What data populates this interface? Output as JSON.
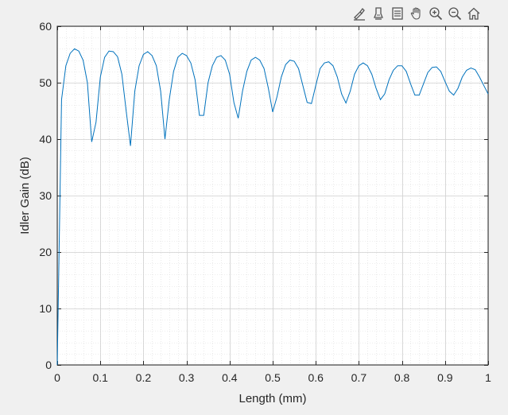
{
  "toolbar": {
    "items": [
      {
        "name": "brush-icon"
      },
      {
        "name": "data-tips-icon"
      },
      {
        "name": "legend-icon"
      },
      {
        "name": "pan-hand-icon"
      },
      {
        "name": "zoom-in-icon"
      },
      {
        "name": "zoom-out-icon"
      },
      {
        "name": "home-icon"
      }
    ]
  },
  "colors": {
    "background": "#f0f0f0",
    "axes_bg": "#ffffff",
    "line": "#0072bd",
    "axis": "#262626"
  },
  "chart_data": {
    "type": "line",
    "title": "",
    "xlabel": "Length (mm)",
    "ylabel": "Idler Gain (dB)",
    "xlim": [
      0,
      1
    ],
    "ylim": [
      0,
      60
    ],
    "xticks": [
      0,
      0.1,
      0.2,
      0.3,
      0.4,
      0.5,
      0.6,
      0.7,
      0.8,
      0.9,
      1
    ],
    "xtick_labels": [
      "0",
      "0.1",
      "0.2",
      "0.3",
      "0.4",
      "0.5",
      "0.6",
      "0.7",
      "0.8",
      "0.9",
      "1"
    ],
    "yticks": [
      0,
      10,
      20,
      30,
      40,
      50,
      60
    ],
    "ytick_labels": [
      "0",
      "10",
      "20",
      "30",
      "40",
      "50",
      "60"
    ],
    "grid": true,
    "minor_grid": true,
    "series": [
      {
        "x": [
          0,
          0.01,
          0.02,
          0.03,
          0.04,
          0.05,
          0.06,
          0.07,
          0.08,
          0.09,
          0.1,
          0.11,
          0.12,
          0.13,
          0.14,
          0.15,
          0.16,
          0.17,
          0.18,
          0.19,
          0.2,
          0.21,
          0.22,
          0.23,
          0.24,
          0.25,
          0.26,
          0.27,
          0.28,
          0.29,
          0.3,
          0.31,
          0.32,
          0.33,
          0.34,
          0.35,
          0.36,
          0.37,
          0.38,
          0.39,
          0.4,
          0.41,
          0.42,
          0.43,
          0.44,
          0.45,
          0.46,
          0.47,
          0.48,
          0.49,
          0.5,
          0.51,
          0.52,
          0.53,
          0.54,
          0.55,
          0.56,
          0.57,
          0.58,
          0.59,
          0.6,
          0.61,
          0.62,
          0.63,
          0.64,
          0.65,
          0.66,
          0.67,
          0.68,
          0.69,
          0.7,
          0.71,
          0.72,
          0.73,
          0.74,
          0.75,
          0.76,
          0.77,
          0.78,
          0.79,
          0.8,
          0.81,
          0.82,
          0.83,
          0.84,
          0.85,
          0.86,
          0.87,
          0.88,
          0.89,
          0.9,
          0.91,
          0.92,
          0.93,
          0.94,
          0.95,
          0.96,
          0.97,
          0.98,
          0.99,
          1.0
        ],
        "y": [
          0,
          47,
          53,
          55.2,
          56,
          55.6,
          54,
          50,
          39.5,
          43,
          51,
          54.5,
          55.6,
          55.5,
          54.6,
          51.5,
          45,
          38.8,
          48.5,
          53,
          55,
          55.5,
          54.8,
          53,
          48.5,
          40,
          47,
          52,
          54.5,
          55.2,
          54.8,
          53.5,
          50.5,
          44.2,
          44.2,
          50,
          53,
          54.5,
          54.8,
          54,
          51.5,
          46.5,
          43.7,
          48.5,
          52,
          54,
          54.5,
          54,
          52.5,
          49,
          44.8,
          47.5,
          51,
          53.2,
          54,
          53.8,
          52.5,
          49.5,
          46.5,
          46.3,
          49.5,
          52.5,
          53.5,
          53.7,
          53,
          51,
          48,
          46.4,
          48.5,
          51.5,
          53,
          53.5,
          53,
          51.5,
          49,
          47,
          48,
          50.5,
          52.2,
          53,
          53,
          52,
          49.8,
          47.8,
          47.8,
          49.8,
          51.8,
          52.7,
          52.8,
          52,
          50.2,
          48.5,
          47.8,
          49,
          51,
          52.2,
          52.6,
          52.3,
          51,
          49.5,
          48
        ]
      }
    ]
  }
}
